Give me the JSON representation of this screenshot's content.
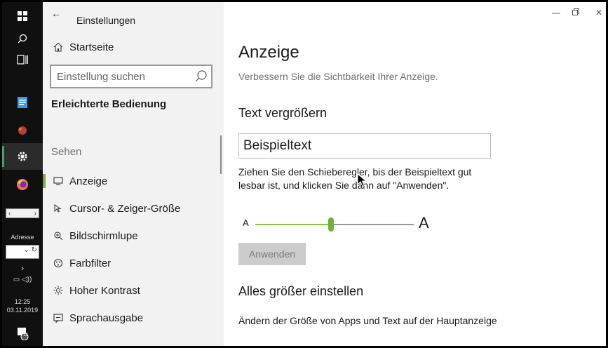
{
  "taskbar": {
    "address_label": "Adresse",
    "time": "12:25",
    "date": "03.11.2019",
    "notif_count": "11",
    "icons": [
      "windows-icon",
      "search-icon",
      "task-view-icon",
      "notepad-icon",
      "app-icon",
      "settings-icon",
      "firefox-icon",
      "notification-icon"
    ]
  },
  "nav": {
    "title": "Einstellungen",
    "home": "Startseite",
    "search_placeholder": "Einstellung suchen",
    "section": "Erleichterte Bedienung",
    "group": "Sehen",
    "items": [
      {
        "label": "Anzeige",
        "icon": "display-icon",
        "selected": true
      },
      {
        "label": "Cursor- & Zeiger-Größe",
        "icon": "cursor-icon"
      },
      {
        "label": "Bildschirmlupe",
        "icon": "magnifier-icon"
      },
      {
        "label": "Farbfilter",
        "icon": "color-filter-icon"
      },
      {
        "label": "Hoher Kontrast",
        "icon": "high-contrast-icon"
      },
      {
        "label": "Sprachausgabe",
        "icon": "narrator-icon"
      }
    ]
  },
  "main": {
    "title": "Anzeige",
    "subtitle": "Verbessern Sie die Sichtbarkeit Ihrer Anzeige.",
    "text_section": "Text vergrößern",
    "sample_text": "Beispieltext",
    "description": "Ziehen Sie den Schieberegler, bis der Beispieltext gut lesbar ist, und klicken Sie dann auf \"Anwenden\".",
    "slider_min_label": "A",
    "slider_max_label": "A",
    "slider_value_fraction": 0.48,
    "apply_label": "Anwenden",
    "everything_section": "Alles größer einstellen",
    "everything_desc": "Ändern der Größe von Apps und Text auf der Hauptanzeige"
  },
  "colors": {
    "accent": "#6bb33a",
    "nav_bg": "#f2f2f2",
    "taskbar_bg": "#101010"
  }
}
